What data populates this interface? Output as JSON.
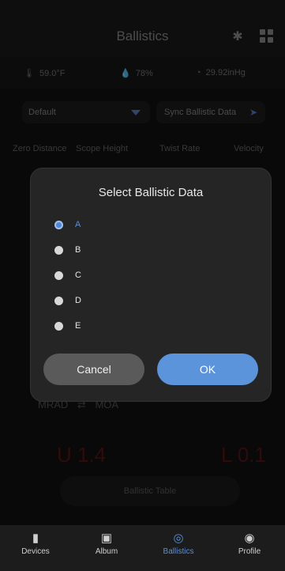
{
  "header": {
    "title": "Ballistics"
  },
  "env": {
    "temperature": "59.0°F",
    "humidity": "78%",
    "pressure": "29.92inHg"
  },
  "profile_select": {
    "value": "Default"
  },
  "sync": {
    "label": "Sync Ballistic Data"
  },
  "columns": [
    "Zero Distance",
    "Scope Height",
    "Twist Rate",
    "Velocity"
  ],
  "units": {
    "from": "MRAD",
    "to": "MOA"
  },
  "correction": {
    "up": "U 1.4",
    "lr": "L 0.1"
  },
  "table_button": {
    "label": "Ballistic Table"
  },
  "modal": {
    "title": "Select Ballistic Data",
    "options": [
      {
        "label": "A",
        "selected": true
      },
      {
        "label": "B",
        "selected": false
      },
      {
        "label": "C",
        "selected": false
      },
      {
        "label": "D",
        "selected": false
      },
      {
        "label": "E",
        "selected": false
      }
    ],
    "cancel_label": "Cancel",
    "ok_label": "OK"
  },
  "nav": {
    "items": [
      {
        "label": "Devices",
        "icon": "device-icon",
        "active": false
      },
      {
        "label": "Album",
        "icon": "image-icon",
        "active": false
      },
      {
        "label": "Ballistics",
        "icon": "target-icon",
        "active": true
      },
      {
        "label": "Profile",
        "icon": "person-icon",
        "active": false
      }
    ]
  },
  "colors": {
    "accent": "#5b94db",
    "modal_bg": "#252525",
    "cancel_bg": "#5a5a5a"
  }
}
